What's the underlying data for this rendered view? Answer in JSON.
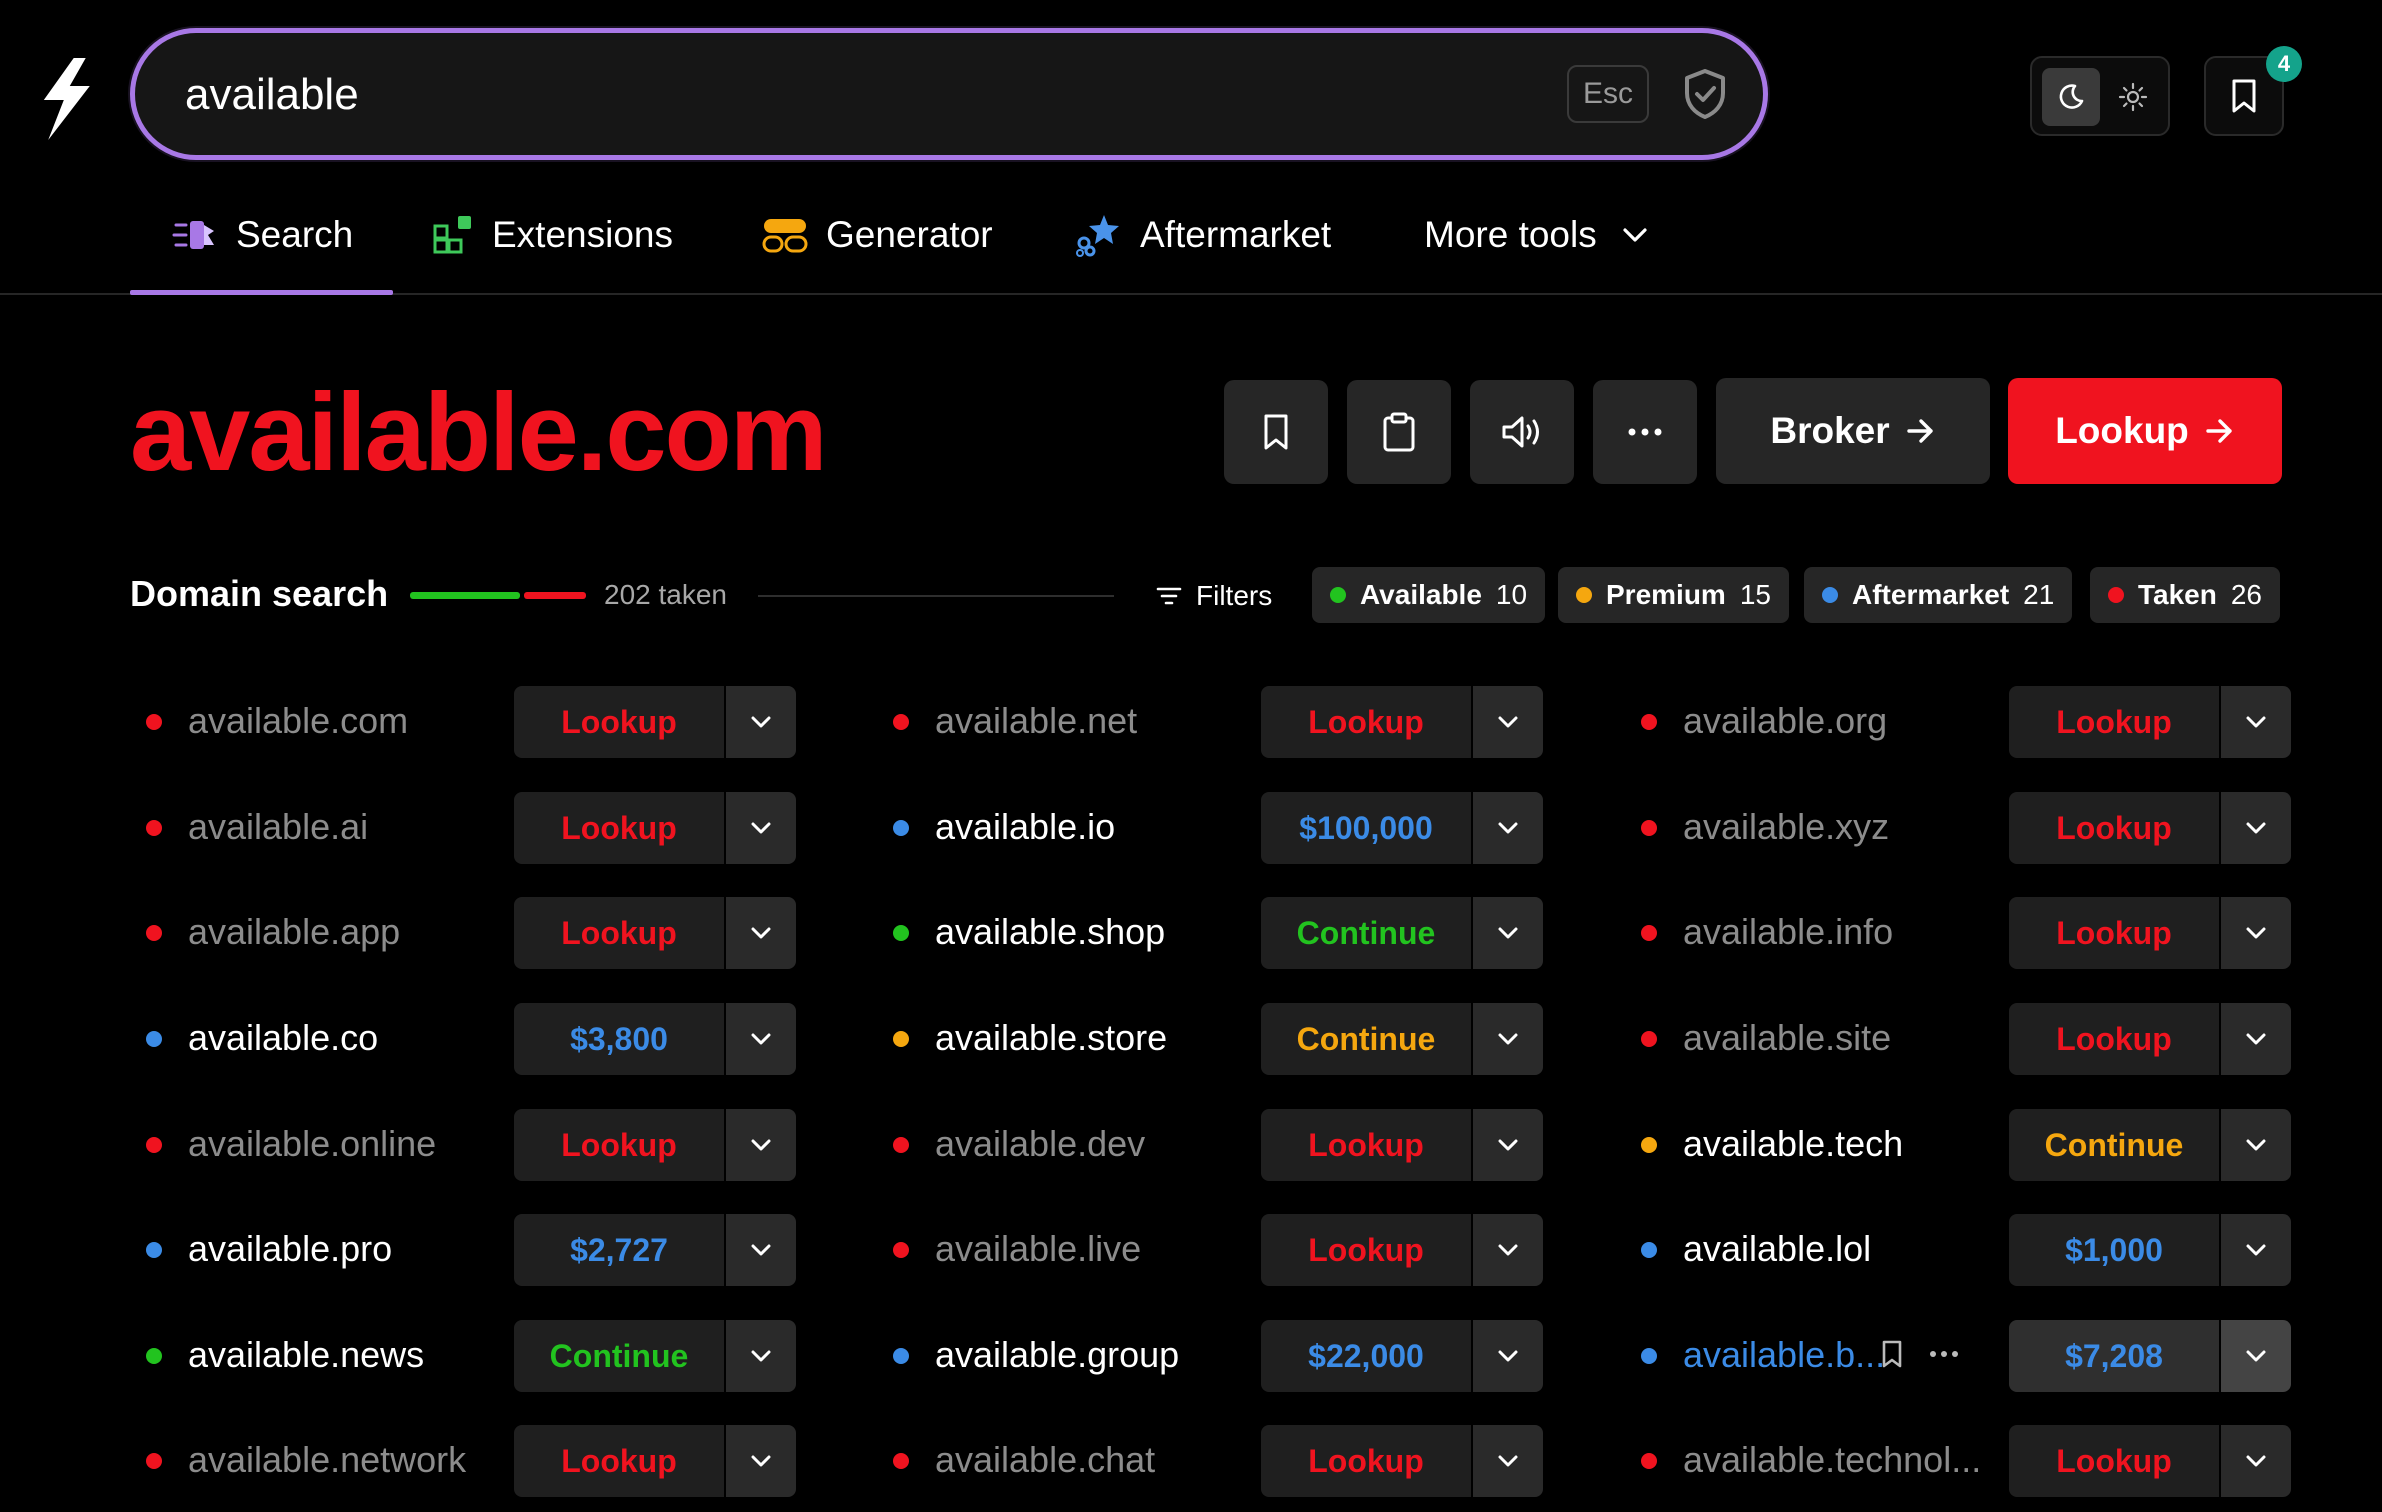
{
  "search": {
    "value": "available",
    "esc_label": "Esc"
  },
  "saved_count": "4",
  "nav": [
    {
      "label": "Search",
      "icon": "search-tool-icon"
    },
    {
      "label": "Extensions",
      "icon": "extensions-icon"
    },
    {
      "label": "Generator",
      "icon": "generator-icon"
    },
    {
      "label": "Aftermarket",
      "icon": "aftermarket-icon"
    },
    {
      "label": "More tools",
      "icon": "chevron-down-icon"
    }
  ],
  "domain_title": "available.com",
  "actions": {
    "broker": "Broker",
    "lookup": "Lookup"
  },
  "domain_search": {
    "label": "Domain search",
    "taken_text": "202 taken",
    "filters_label": "Filters",
    "chips": [
      {
        "label": "Available",
        "count": "10",
        "color": "#22c31f"
      },
      {
        "label": "Premium",
        "count": "15",
        "color": "#f5a70f"
      },
      {
        "label": "Aftermarket",
        "count": "21",
        "color": "#3b8be6"
      },
      {
        "label": "Taken",
        "count": "26",
        "color": "#f0131f"
      }
    ]
  },
  "colors": {
    "taken": "#f0131f",
    "available": "#22c31f",
    "premium": "#f5a70f",
    "aftermarket": "#3b8be6",
    "accent": "#a878e6"
  },
  "domains": [
    [
      {
        "name": "available.com",
        "status": "taken",
        "action": "Lookup"
      },
      {
        "name": "available.ai",
        "status": "taken",
        "action": "Lookup"
      },
      {
        "name": "available.app",
        "status": "taken",
        "action": "Lookup"
      },
      {
        "name": "available.co",
        "status": "aftermarket",
        "action": "$3,800"
      },
      {
        "name": "available.online",
        "status": "taken",
        "action": "Lookup"
      },
      {
        "name": "available.pro",
        "status": "aftermarket",
        "action": "$2,727"
      },
      {
        "name": "available.news",
        "status": "available",
        "action": "Continue"
      },
      {
        "name": "available.network",
        "status": "taken",
        "action": "Lookup"
      }
    ],
    [
      {
        "name": "available.net",
        "status": "taken",
        "action": "Lookup"
      },
      {
        "name": "available.io",
        "status": "aftermarket",
        "action": "$100,000"
      },
      {
        "name": "available.shop",
        "status": "available",
        "action": "Continue"
      },
      {
        "name": "available.store",
        "status": "premium",
        "action": "Continue"
      },
      {
        "name": "available.dev",
        "status": "taken",
        "action": "Lookup"
      },
      {
        "name": "available.live",
        "status": "taken",
        "action": "Lookup"
      },
      {
        "name": "available.group",
        "status": "aftermarket",
        "action": "$22,000"
      },
      {
        "name": "available.chat",
        "status": "taken",
        "action": "Lookup"
      }
    ],
    [
      {
        "name": "available.org",
        "status": "taken",
        "action": "Lookup"
      },
      {
        "name": "available.xyz",
        "status": "taken",
        "action": "Lookup"
      },
      {
        "name": "available.info",
        "status": "taken",
        "action": "Lookup"
      },
      {
        "name": "available.site",
        "status": "taken",
        "action": "Lookup"
      },
      {
        "name": "available.tech",
        "status": "premium",
        "action": "Continue"
      },
      {
        "name": "available.lol",
        "status": "aftermarket",
        "action": "$1,000"
      },
      {
        "name": "available.b...",
        "status": "aftermarket",
        "action": "$7,208",
        "hovered": true
      },
      {
        "name": "available.technol...",
        "status": "taken",
        "action": "Lookup"
      }
    ]
  ]
}
